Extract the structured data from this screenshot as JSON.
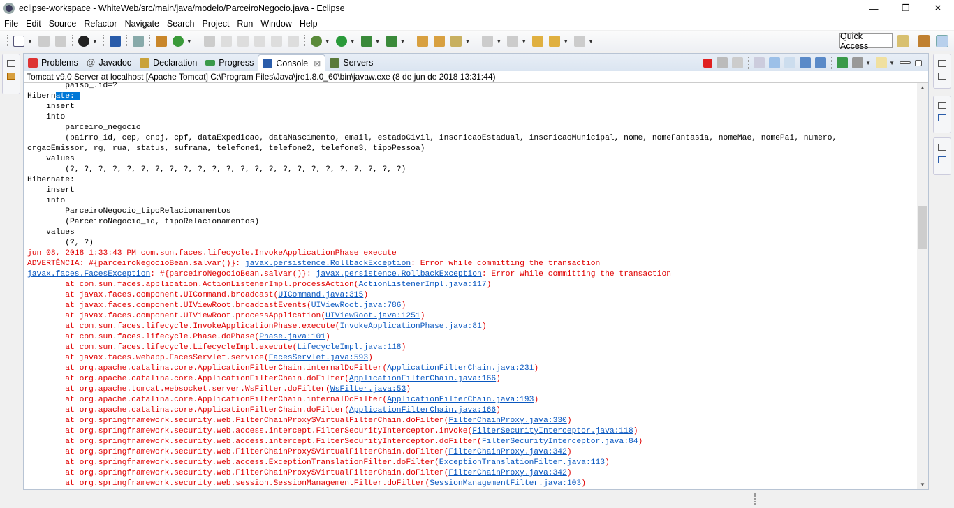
{
  "window": {
    "title": "eclipse-workspace - WhiteWeb/src/main/java/modelo/ParceiroNegocio.java - Eclipse",
    "minimize": "—",
    "restore": "❐",
    "close": "✕"
  },
  "menu": [
    "File",
    "Edit",
    "Source",
    "Refactor",
    "Navigate",
    "Search",
    "Project",
    "Run",
    "Window",
    "Help"
  ],
  "quick_access": "Quick Access",
  "tabs": [
    {
      "label": "Problems",
      "icon": "problems-icon",
      "color": "#d33"
    },
    {
      "label": "Javadoc",
      "icon": "javadoc-icon",
      "color": "#fff"
    },
    {
      "label": "Declaration",
      "icon": "declaration-icon",
      "color": "#c9a23a"
    },
    {
      "label": "Progress",
      "icon": "progress-icon",
      "color": "#3a9a4a"
    },
    {
      "label": "Console",
      "icon": "console-icon",
      "color": "#2a5caa",
      "active": true
    },
    {
      "label": "Servers",
      "icon": "servers-icon",
      "color": "#5a7a3a"
    }
  ],
  "tab_close": "⊠",
  "javadoc_glyph": "@",
  "console_status": "Tomcat v9.0 Server at localhost [Apache Tomcat] C:\\Program Files\\Java\\jre1.8.0_60\\bin\\javaw.exe (8 de jun de 2018 13:31:44)",
  "console_lines": [
    [
      [
        "        paiso_.id=?",
        "n"
      ]
    ],
    [
      [
        "Hibern",
        "n"
      ],
      [
        "ate: ",
        "h"
      ]
    ],
    [
      [
        "    insert",
        "n"
      ]
    ],
    [
      [
        "    into",
        "n"
      ]
    ],
    [
      [
        "        parceiro_negocio",
        "n"
      ]
    ],
    [
      [
        "        (bairro_id, cep, cnpj, cpf, dataExpedicao, dataNascimento, email, estadoCivil, inscricaoEstadual, inscricaoMunicipal, nome, nomeFantasia, nomeMae, nomePai, numero,",
        "n"
      ]
    ],
    [
      [
        "orgaoEmissor, rg, rua, status, suframa, telefone1, telefone2, telefone3, tipoPessoa)",
        "n"
      ]
    ],
    [
      [
        "    values",
        "n"
      ]
    ],
    [
      [
        "        (?, ?, ?, ?, ?, ?, ?, ?, ?, ?, ?, ?, ?, ?, ?, ?, ?, ?, ?, ?, ?, ?, ?, ?)",
        "n"
      ]
    ],
    [
      [
        "Hibernate: ",
        "n"
      ]
    ],
    [
      [
        "    insert",
        "n"
      ]
    ],
    [
      [
        "    into",
        "n"
      ]
    ],
    [
      [
        "        ParceiroNegocio_tipoRelacionamentos",
        "n"
      ]
    ],
    [
      [
        "        (ParceiroNegocio_id, tipoRelacionamentos)",
        "n"
      ]
    ],
    [
      [
        "    values",
        "n"
      ]
    ],
    [
      [
        "        (?, ?)",
        "n"
      ]
    ],
    [
      [
        "jun 08, 2018 1:33:43 PM com.sun.faces.lifecycle.InvokeApplicationPhase execute",
        "r"
      ]
    ],
    [
      [
        "ADVERTÊNCIA: #{parceiroNegocioBean.salvar()}: ",
        "r"
      ],
      [
        "javax.persistence.RollbackException",
        "l"
      ],
      [
        ": Error while committing the transaction",
        "r"
      ]
    ],
    [
      [
        "javax.faces.FacesException",
        "l"
      ],
      [
        ": #{parceiroNegocioBean.salvar()}: ",
        "r"
      ],
      [
        "javax.persistence.RollbackException",
        "l"
      ],
      [
        ": Error while committing the transaction",
        "r"
      ]
    ],
    [
      [
        "\tat com.sun.faces.application.ActionListenerImpl.processAction(",
        "r"
      ],
      [
        "ActionListenerImpl.java:117",
        "l"
      ],
      [
        ")",
        "r"
      ]
    ],
    [
      [
        "\tat javax.faces.component.UICommand.broadcast(",
        "r"
      ],
      [
        "UICommand.java:315",
        "l"
      ],
      [
        ")",
        "r"
      ]
    ],
    [
      [
        "\tat javax.faces.component.UIViewRoot.broadcastEvents(",
        "r"
      ],
      [
        "UIViewRoot.java:786",
        "l"
      ],
      [
        ")",
        "r"
      ]
    ],
    [
      [
        "\tat javax.faces.component.UIViewRoot.processApplication(",
        "r"
      ],
      [
        "UIViewRoot.java:1251",
        "l"
      ],
      [
        ")",
        "r"
      ]
    ],
    [
      [
        "\tat com.sun.faces.lifecycle.InvokeApplicationPhase.execute(",
        "r"
      ],
      [
        "InvokeApplicationPhase.java:81",
        "l"
      ],
      [
        ")",
        "r"
      ]
    ],
    [
      [
        "\tat com.sun.faces.lifecycle.Phase.doPhase(",
        "r"
      ],
      [
        "Phase.java:101",
        "l"
      ],
      [
        ")",
        "r"
      ]
    ],
    [
      [
        "\tat com.sun.faces.lifecycle.LifecycleImpl.execute(",
        "r"
      ],
      [
        "LifecycleImpl.java:118",
        "l"
      ],
      [
        ")",
        "r"
      ]
    ],
    [
      [
        "\tat javax.faces.webapp.FacesServlet.service(",
        "r"
      ],
      [
        "FacesServlet.java:593",
        "l"
      ],
      [
        ")",
        "r"
      ]
    ],
    [
      [
        "\tat org.apache.catalina.core.ApplicationFilterChain.internalDoFilter(",
        "r"
      ],
      [
        "ApplicationFilterChain.java:231",
        "l"
      ],
      [
        ")",
        "r"
      ]
    ],
    [
      [
        "\tat org.apache.catalina.core.ApplicationFilterChain.doFilter(",
        "r"
      ],
      [
        "ApplicationFilterChain.java:166",
        "l"
      ],
      [
        ")",
        "r"
      ]
    ],
    [
      [
        "\tat org.apache.tomcat.websocket.server.WsFilter.doFilter(",
        "r"
      ],
      [
        "WsFilter.java:53",
        "l"
      ],
      [
        ")",
        "r"
      ]
    ],
    [
      [
        "\tat org.apache.catalina.core.ApplicationFilterChain.internalDoFilter(",
        "r"
      ],
      [
        "ApplicationFilterChain.java:193",
        "l"
      ],
      [
        ")",
        "r"
      ]
    ],
    [
      [
        "\tat org.apache.catalina.core.ApplicationFilterChain.doFilter(",
        "r"
      ],
      [
        "ApplicationFilterChain.java:166",
        "l"
      ],
      [
        ")",
        "r"
      ]
    ],
    [
      [
        "\tat org.springframework.security.web.FilterChainProxy$VirtualFilterChain.doFilter(",
        "r"
      ],
      [
        "FilterChainProxy.java:330",
        "l"
      ],
      [
        ")",
        "r"
      ]
    ],
    [
      [
        "\tat org.springframework.security.web.access.intercept.FilterSecurityInterceptor.invoke(",
        "r"
      ],
      [
        "FilterSecurityInterceptor.java:118",
        "l"
      ],
      [
        ")",
        "r"
      ]
    ],
    [
      [
        "\tat org.springframework.security.web.access.intercept.FilterSecurityInterceptor.doFilter(",
        "r"
      ],
      [
        "FilterSecurityInterceptor.java:84",
        "l"
      ],
      [
        ")",
        "r"
      ]
    ],
    [
      [
        "\tat org.springframework.security.web.FilterChainProxy$VirtualFilterChain.doFilter(",
        "r"
      ],
      [
        "FilterChainProxy.java:342",
        "l"
      ],
      [
        ")",
        "r"
      ]
    ],
    [
      [
        "\tat org.springframework.security.web.access.ExceptionTranslationFilter.doFilter(",
        "r"
      ],
      [
        "ExceptionTranslationFilter.java:113",
        "l"
      ],
      [
        ")",
        "r"
      ]
    ],
    [
      [
        "\tat org.springframework.security.web.FilterChainProxy$VirtualFilterChain.doFilter(",
        "r"
      ],
      [
        "FilterChainProxy.java:342",
        "l"
      ],
      [
        ")",
        "r"
      ]
    ],
    [
      [
        "\tat org.springframework.security.web.session.SessionManagementFilter.doFilter(",
        "r"
      ],
      [
        "SessionManagementFilter.java:103",
        "l"
      ],
      [
        ")",
        "r"
      ]
    ]
  ],
  "scroll_arrows": {
    "up": "▲",
    "down": "▼"
  }
}
